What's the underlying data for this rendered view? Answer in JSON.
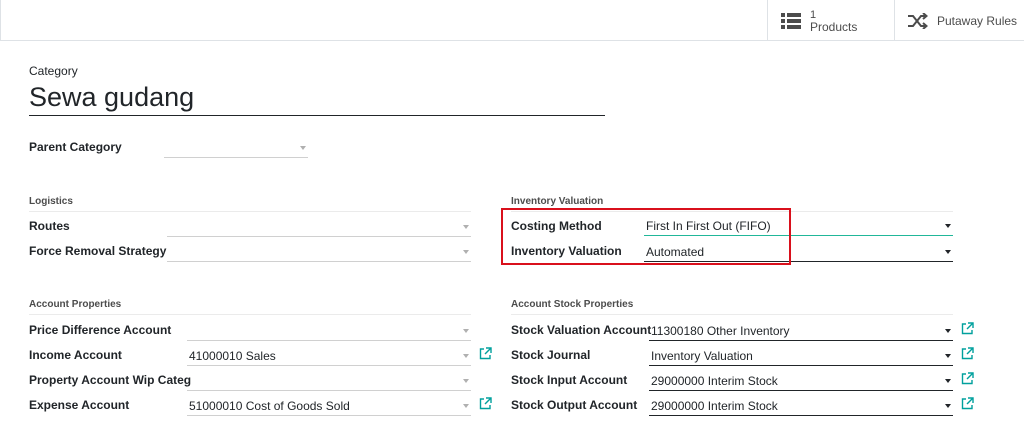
{
  "smart_buttons": {
    "products": {
      "count": "1",
      "label": "Products",
      "icon": "list-icon"
    },
    "putaway": {
      "label": "Putaway Rules",
      "icon": "shuffle-icon"
    }
  },
  "form": {
    "category_label": "Category",
    "category_name": "Sewa gudang",
    "parent_category": {
      "label": "Parent Category",
      "value": ""
    }
  },
  "logistics": {
    "title": "Logistics",
    "routes": {
      "label": "Routes",
      "value": ""
    },
    "removal": {
      "label": "Force Removal Strategy",
      "value": ""
    }
  },
  "inventory_valuation": {
    "title": "Inventory Valuation",
    "costing": {
      "label": "Costing Method",
      "value": "First In First Out (FIFO)"
    },
    "valuation": {
      "label": "Inventory Valuation",
      "value": "Automated"
    }
  },
  "account_properties": {
    "title": "Account Properties",
    "price_diff": {
      "label": "Price Difference Account",
      "value": ""
    },
    "income": {
      "label": "Income Account",
      "value": "41000010 Sales"
    },
    "wip": {
      "label": "Property Account Wip Categ",
      "value": ""
    },
    "expense": {
      "label": "Expense Account",
      "value": "51000010 Cost of Goods Sold"
    }
  },
  "account_stock": {
    "title": "Account Stock Properties",
    "valuation_acc": {
      "label": "Stock Valuation Account",
      "value": "11300180 Other Inventory"
    },
    "journal": {
      "label": "Stock Journal",
      "value": "Inventory Valuation"
    },
    "input": {
      "label": "Stock Input Account",
      "value": "29000000 Interim Stock"
    },
    "output": {
      "label": "Stock Output Account",
      "value": "29000000 Interim Stock"
    }
  },
  "colors": {
    "highlight": "#d9101c",
    "focus": "#21b799",
    "text": "#212529"
  }
}
